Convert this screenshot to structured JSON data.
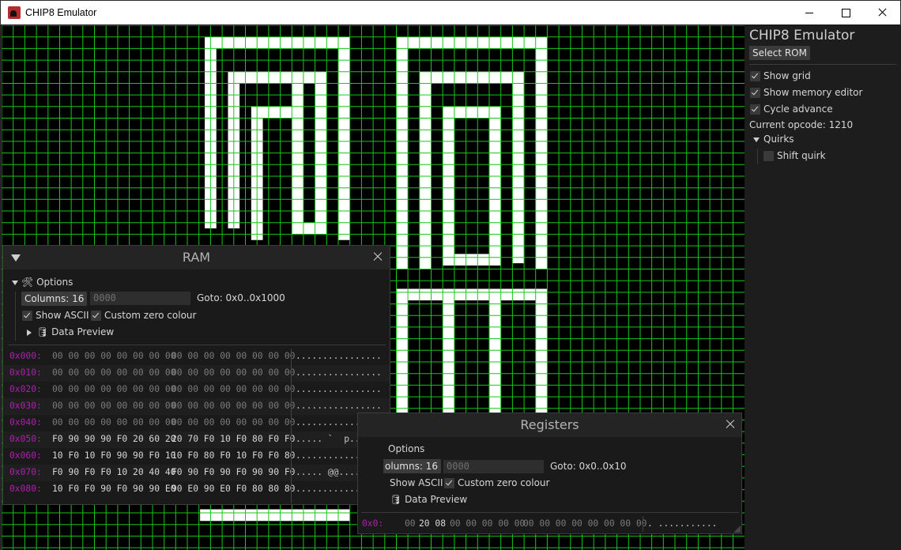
{
  "window": {
    "title": "CHIP8 Emulator"
  },
  "display": {
    "background": "#000000",
    "pixel_color": "#ffffff",
    "grid_color": "#17c617"
  },
  "sidebar": {
    "title": "CHIP8 Emulator",
    "select_rom": "Select ROM",
    "show_grid": {
      "label": "Show grid",
      "checked": true
    },
    "show_memory_editor": {
      "label": "Show memory editor",
      "checked": true
    },
    "cycle_advance": {
      "label": "Cycle advance",
      "checked": true
    },
    "current_opcode": "Current opcode: 1210",
    "quirks": {
      "label": "Quirks",
      "shift_quirk": {
        "label": "Shift quirk",
        "checked": false
      }
    }
  },
  "ram": {
    "title": "RAM",
    "options_label": "Options",
    "columns_button": "Columns: 16",
    "goto_placeholder": "0000",
    "goto_label": "Goto: 0x0..0x1000",
    "show_ascii": "Show ASCII",
    "custom_zero_colour": "Custom zero colour",
    "data_preview": "Data Preview",
    "rows": [
      {
        "addr": "0x000:",
        "b1": "00 00 00 00 00 00 00 00",
        "b2": "00 00 00 00 00 00 00 00",
        "ascii": "................",
        "hot": false
      },
      {
        "addr": "0x010:",
        "b1": "00 00 00 00 00 00 00 00",
        "b2": "00 00 00 00 00 00 00 00",
        "ascii": "................",
        "hot": false
      },
      {
        "addr": "0x020:",
        "b1": "00 00 00 00 00 00 00 00",
        "b2": "00 00 00 00 00 00 00 00",
        "ascii": "................",
        "hot": false
      },
      {
        "addr": "0x030:",
        "b1": "00 00 00 00 00 00 00 00",
        "b2": "00 00 00 00 00 00 00 00",
        "ascii": "................",
        "hot": false
      },
      {
        "addr": "0x040:",
        "b1": "00 00 00 00 00 00 00 00",
        "b2": "00 00 00 00 00 00 00 00",
        "ascii": "................",
        "hot": false
      },
      {
        "addr": "0x050:",
        "b1": "F0 90 90 90 F0 20 60 20",
        "b2": "20 70 F0 10 F0 80 F0 F0",
        "ascii": "..... `  p.....",
        "hot": true
      },
      {
        "addr": "0x060:",
        "b1": "10 F0 10 F0 90 90 F0 10",
        "b2": "10 F0 80 F0 10 F0 F0 80",
        "ascii": "................",
        "hot": true
      },
      {
        "addr": "0x070:",
        "b1": "F0 90 F0 F0 10 20 40 40",
        "b2": "F0 90 F0 90 F0 90 90 F0",
        "ascii": "..... @@........",
        "hot": true
      },
      {
        "addr": "0x080:",
        "b1": "10 F0 F0 90 F0 90 90 E0",
        "b2": "90 E0 90 E0 F0 80 80 80",
        "ascii": "................",
        "hot": true
      }
    ]
  },
  "registers": {
    "title": "Registers",
    "options_label": "Options",
    "columns_button": "olumns: 16",
    "goto_placeholder": "0000",
    "goto_label": "Goto: 0x0..0x10",
    "show_ascii": "Show ASCII",
    "custom_zero_colour": "Custom zero colour",
    "data_preview": "Data Preview",
    "row": {
      "addr": "0x0:",
      "b1a": "00",
      "b1b": "20 08",
      "b1c": "00 00 00 00 00",
      "b2": "00 00 00 00 00 00 00 00",
      "ascii": ". ..........."
    }
  }
}
